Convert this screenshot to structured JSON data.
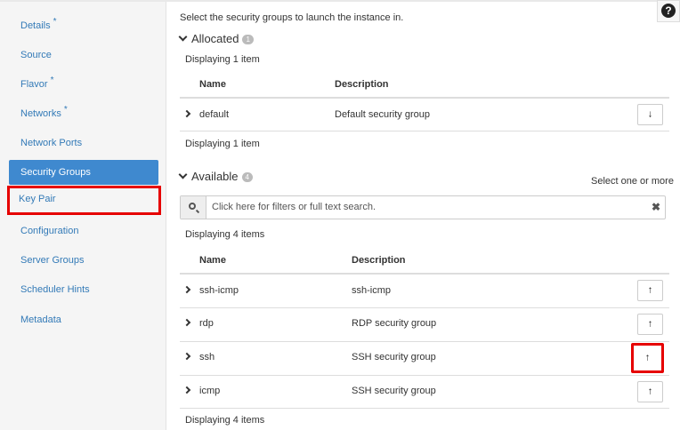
{
  "sidebar": {
    "items": [
      {
        "label": "Details",
        "required": "*"
      },
      {
        "label": "Source",
        "required": ""
      },
      {
        "label": "Flavor",
        "required": "*"
      },
      {
        "label": "Networks",
        "required": "*"
      },
      {
        "label": "Network Ports",
        "required": ""
      },
      {
        "label": "Security Groups",
        "required": ""
      },
      {
        "label": "Key Pair",
        "required": ""
      },
      {
        "label": "Configuration",
        "required": ""
      },
      {
        "label": "Server Groups",
        "required": ""
      },
      {
        "label": "Scheduler Hints",
        "required": ""
      },
      {
        "label": "Metadata",
        "required": ""
      }
    ],
    "active": "Security Groups"
  },
  "help": {
    "glyph": "?"
  },
  "main": {
    "intro": "Select the security groups to launch the instance in.",
    "allocated": {
      "title": "Allocated",
      "count": "1",
      "displaying_top": "Displaying 1 item",
      "displaying_bottom": "Displaying 1 item",
      "headers": {
        "name": "Name",
        "description": "Description"
      },
      "rows": [
        {
          "name": "default",
          "description": "Default security group",
          "action": "↓"
        }
      ]
    },
    "available": {
      "title": "Available",
      "count": "4",
      "select_hint": "Select one or more",
      "search_placeholder": "Click here for filters or full text search.",
      "clear_glyph": "✖",
      "displaying_top": "Displaying 4 items",
      "displaying_bottom": "Displaying 4 items",
      "headers": {
        "name": "Name",
        "description": "Description"
      },
      "rows": [
        {
          "name": "ssh-icmp",
          "description": "ssh-icmp",
          "action": "↑"
        },
        {
          "name": "rdp",
          "description": "RDP security group",
          "action": "↑"
        },
        {
          "name": "ssh",
          "description": "SSH security group",
          "action": "↑"
        },
        {
          "name": "icmp",
          "description": "SSH security group",
          "action": "↑"
        }
      ]
    }
  },
  "colors": {
    "accent": "#3f89cf",
    "highlight": "#e60000",
    "link": "#337ab7"
  }
}
